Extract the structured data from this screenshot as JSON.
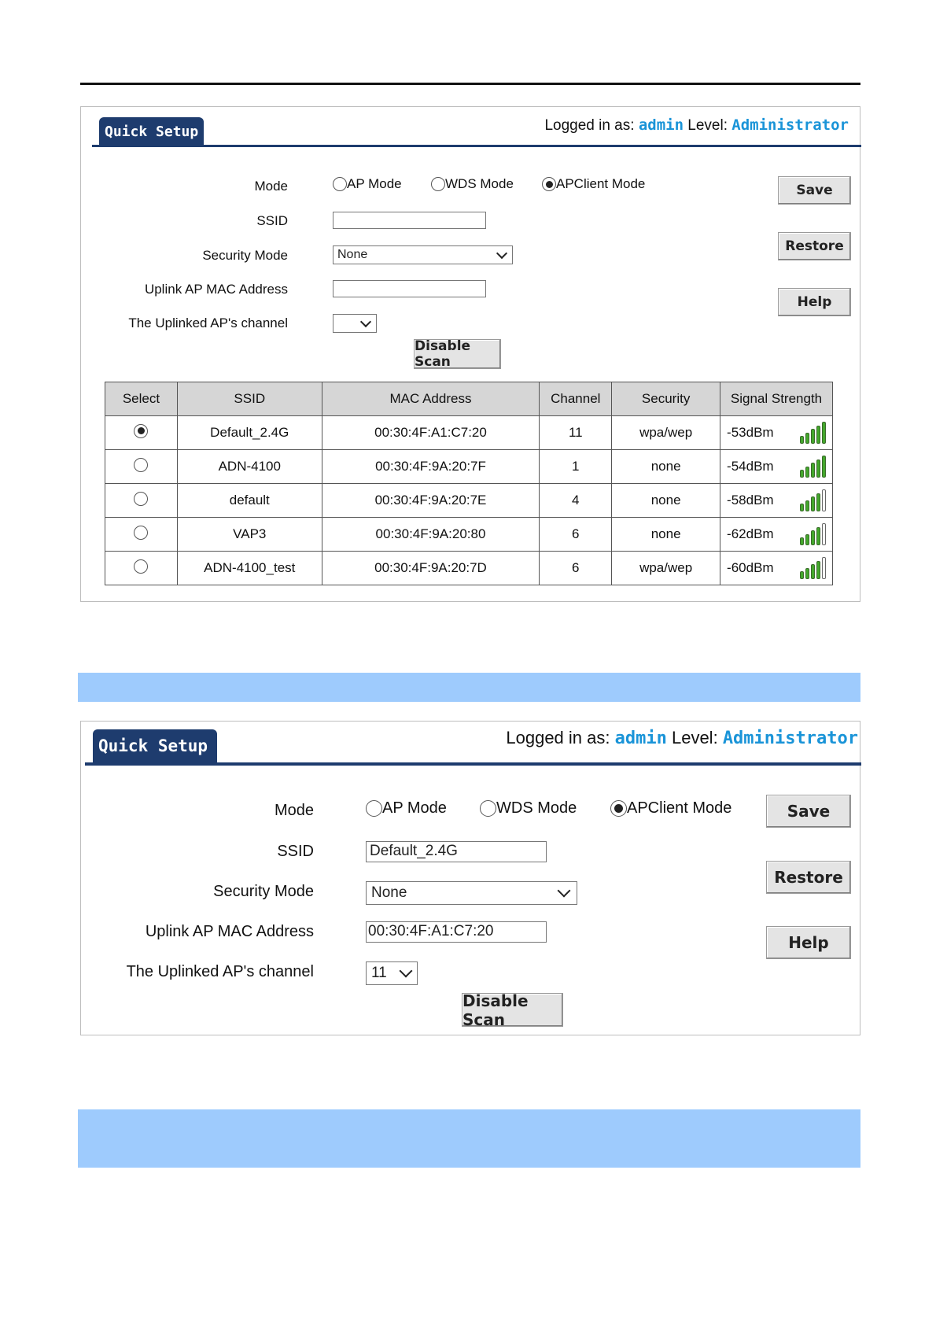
{
  "screens": [
    {
      "tab": "Quick Setup",
      "login": {
        "prefix": "Logged in as:",
        "user": "admin",
        "level_label": "Level:",
        "level": "Administrator"
      },
      "labels": {
        "mode": "Mode",
        "ssid": "SSID",
        "security": "Security Mode",
        "mac": "Uplink AP MAC Address",
        "channel": "The Uplinked AP's channel"
      },
      "mode_options": [
        "AP Mode",
        "WDS Mode",
        "APClient Mode"
      ],
      "mode_selected": "APClient Mode",
      "ssid_value": "",
      "security_value": "None",
      "mac_value": "",
      "channel_value": "",
      "buttons": {
        "save": "Save",
        "restore": "Restore",
        "help": "Help",
        "scan": "Disable Scan"
      },
      "table": {
        "headers": [
          "Select",
          "SSID",
          "MAC Address",
          "Channel",
          "Security",
          "Signal Strength"
        ],
        "rows": [
          {
            "selected": true,
            "ssid": "Default_2.4G",
            "mac": "00:30:4F:A1:C7:20",
            "channel": "11",
            "security": "wpa/wep",
            "signal": "-53dBm",
            "bars": 5
          },
          {
            "selected": false,
            "ssid": "ADN-4100",
            "mac": "00:30:4F:9A:20:7F",
            "channel": "1",
            "security": "none",
            "signal": "-54dBm",
            "bars": 5
          },
          {
            "selected": false,
            "ssid": "default",
            "mac": "00:30:4F:9A:20:7E",
            "channel": "4",
            "security": "none",
            "signal": "-58dBm",
            "bars": 4
          },
          {
            "selected": false,
            "ssid": "VAP3",
            "mac": "00:30:4F:9A:20:80",
            "channel": "6",
            "security": "none",
            "signal": "-62dBm",
            "bars": 4
          },
          {
            "selected": false,
            "ssid": "ADN-4100_test",
            "mac": "00:30:4F:9A:20:7D",
            "channel": "6",
            "security": "wpa/wep",
            "signal": "-60dBm",
            "bars": 4
          }
        ]
      }
    },
    {
      "tab": "Quick Setup",
      "login": {
        "prefix": "Logged in as:",
        "user": "admin",
        "level_label": "Level:",
        "level": "Administrator"
      },
      "labels": {
        "mode": "Mode",
        "ssid": "SSID",
        "security": "Security Mode",
        "mac": "Uplink AP MAC Address",
        "channel": "The Uplinked AP's channel"
      },
      "mode_options": [
        "AP Mode",
        "WDS Mode",
        "APClient Mode"
      ],
      "mode_selected": "APClient Mode",
      "ssid_value": "Default_2.4G",
      "security_value": "None",
      "mac_value": "00:30:4F:A1:C7:20",
      "channel_value": "11",
      "buttons": {
        "save": "Save",
        "restore": "Restore",
        "help": "Help",
        "scan": "Disable Scan"
      }
    }
  ]
}
